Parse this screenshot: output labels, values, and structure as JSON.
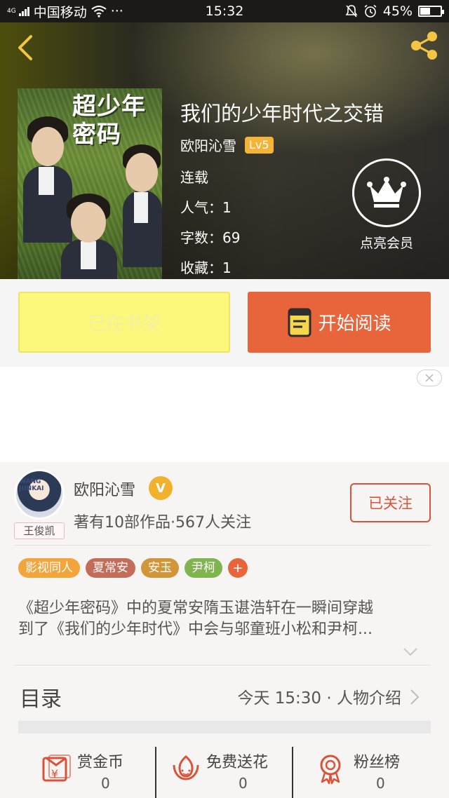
{
  "status_bar": {
    "network_badge": "4G",
    "carrier": "中国移动",
    "more": "···",
    "time": "15:32",
    "battery_text": "45%",
    "battery_level": 0.45
  },
  "book": {
    "cover_title": "超少年密码",
    "title": "我们的少年时代之交错",
    "author": "欧阳沁雪",
    "level": "Lv5",
    "status": "连载",
    "popularity": "人气：1",
    "word_count": "字数：69",
    "favorites": "收藏：1"
  },
  "vip": {
    "label": "点亮会员"
  },
  "actions": {
    "shelf_label": "已在书架",
    "read_label": "开始阅读"
  },
  "author_card": {
    "avatar_text": "WANG JUNKAI",
    "avatar_tag": "王俊凯",
    "name": "欧阳沁雪",
    "verified_badge": "V",
    "stats": "著有10部作品·567人关注",
    "follow_label": "已关注"
  },
  "tags": [
    {
      "label": "影视同人",
      "color": "#f3a43a"
    },
    {
      "label": "夏常安",
      "color": "#c46c5a"
    },
    {
      "label": "安玉",
      "color": "#d2963a"
    },
    {
      "label": "尹柯",
      "color": "#7fb44e"
    }
  ],
  "tag_add": "+",
  "description": {
    "line1": "《超少年密码》中的夏常安隋玉谌浩轩在一瞬间穿越",
    "line2": "到了《我们的少年时代》中会与邬童班小松和尹柯..."
  },
  "toc": {
    "label": "目录",
    "update": "今天 15:30 · 人物介绍"
  },
  "bottom_bar": [
    {
      "label": "赏金币",
      "count": "0",
      "icon": "reward-coin-icon"
    },
    {
      "label": "免费送花",
      "count": "0",
      "icon": "flower-icon"
    },
    {
      "label": "粉丝榜",
      "count": "0",
      "icon": "medal-icon"
    }
  ],
  "colors": {
    "accent": "#e8643a",
    "shelf_button": "#fbf87c",
    "level_badge": "#f4b536",
    "follow": "#d9533a",
    "icon_red": "#d9533a"
  }
}
